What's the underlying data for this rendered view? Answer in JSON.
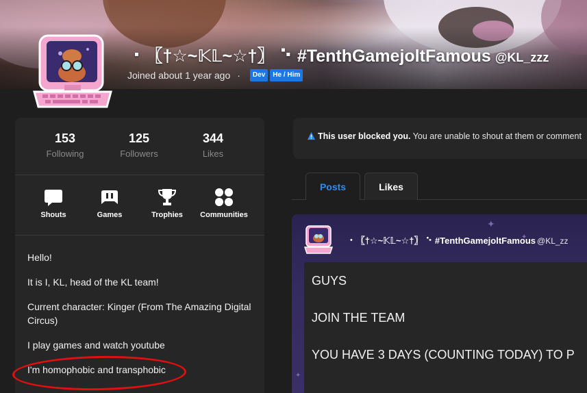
{
  "profile": {
    "display_name": "⠐ 〖†☆~𝕂𝕃~☆†〗 ⠑ #TenthGamejoltFamous",
    "handle": "@KL_zzz",
    "joined": "Joined about 1 year ago",
    "separator": "·",
    "tags": [
      "Dev",
      "He / Him"
    ]
  },
  "stats": [
    {
      "value": "153",
      "label": "Following"
    },
    {
      "value": "125",
      "label": "Followers"
    },
    {
      "value": "344",
      "label": "Likes"
    }
  ],
  "nav": [
    {
      "label": "Shouts",
      "icon": "shouts-icon"
    },
    {
      "label": "Games",
      "icon": "gamepad-icon"
    },
    {
      "label": "Trophies",
      "icon": "trophy-icon"
    },
    {
      "label": "Communities",
      "icon": "communities-icon"
    }
  ],
  "bio": [
    "Hello!",
    "It is I, KL, head of the KL team!",
    "Current character: Kinger (From The Amazing Digital Circus)",
    "I play games and watch youtube",
    "I'm homophobic and transphobic"
  ],
  "blocked_notice": {
    "bold": "This user blocked you.",
    "text": " You are unable to shout at them or comment"
  },
  "tabs": [
    {
      "label": "Posts",
      "active": true
    },
    {
      "label": "Likes",
      "active": false
    }
  ],
  "post": {
    "author_name": "⠐ 〖†☆~𝕂𝕃~☆†〗 ⠑ #TenthGamejoltFamous",
    "author_handle": "@KL_zz",
    "lines": [
      "GUYS",
      "JOIN THE TEAM",
      "YOU HAVE 3 DAYS (COUNTING TODAY) TO P"
    ]
  },
  "colors": {
    "accent": "#2b8cf5",
    "tag_bg": "#1a78e6",
    "annotation": "#e01010",
    "panel": "#262626",
    "page": "#1e1e1e"
  }
}
